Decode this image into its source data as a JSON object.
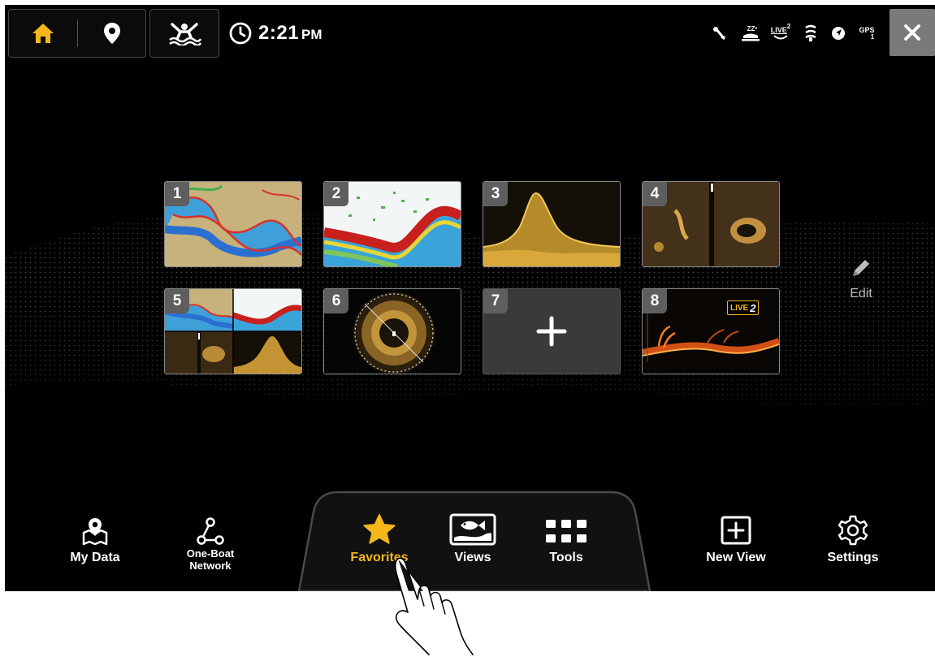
{
  "topbar": {
    "time": "2:21",
    "ampm": "PM",
    "status_icons": [
      "sonar-ping-icon",
      "sleep-mode-icon",
      "live-sonar-icon",
      "transducer-icon",
      "heading-icon",
      "gps-icon"
    ]
  },
  "status_text": {
    "sleep": "ZZᶻ",
    "live": "LIVE",
    "live_sup": "2",
    "gps": "GPS",
    "gps_sub": "1"
  },
  "favorites": {
    "tiles": [
      {
        "number": "1",
        "type": "chart-view"
      },
      {
        "number": "2",
        "type": "sonar-view"
      },
      {
        "number": "3",
        "type": "down-imaging-view"
      },
      {
        "number": "4",
        "type": "side-imaging-view"
      },
      {
        "number": "5",
        "type": "combo-view"
      },
      {
        "number": "6",
        "type": "360-imaging-view"
      },
      {
        "number": "7",
        "type": "empty"
      },
      {
        "number": "8",
        "type": "live-sonar-view"
      }
    ],
    "live_badge": "LIVE",
    "live_badge_num": "2",
    "edit_label": "Edit"
  },
  "bottom_nav": {
    "my_data": "My Data",
    "one_boat_1": "One-Boat",
    "one_boat_2": "Network",
    "favorites": "Favorites",
    "views": "Views",
    "tools": "Tools",
    "new_view": "New View",
    "settings": "Settings"
  },
  "colors": {
    "accent": "#f3b71b",
    "background": "#000000",
    "button_border": "#4a4a4a"
  }
}
